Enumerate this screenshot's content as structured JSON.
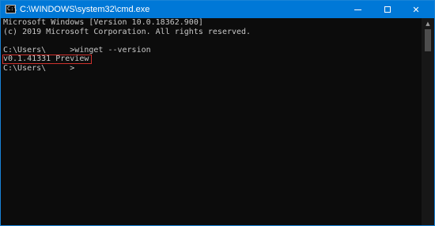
{
  "window": {
    "title": "C:\\WINDOWS\\system32\\cmd.exe",
    "icon": "cmd-icon",
    "icon_glyph": "C:\\",
    "controls": {
      "minimize": "minimize-icon",
      "maximize": "maximize-icon",
      "close": "✕"
    }
  },
  "console": {
    "lines": [
      "Microsoft Windows [Version 10.0.18362.900]",
      "(c) 2019 Microsoft Corporation. All rights reserved.",
      "",
      "C:\\Users\\     >winget --version",
      "v0.1.41331 Preview",
      "C:\\Users\\     >"
    ],
    "highlight_color": "#d0312d",
    "text_color": "#c8c8c8",
    "background": "#0c0c0c"
  },
  "scrollbar": {
    "up_arrow": "▲"
  },
  "colors": {
    "titlebar": "#0078d7"
  }
}
